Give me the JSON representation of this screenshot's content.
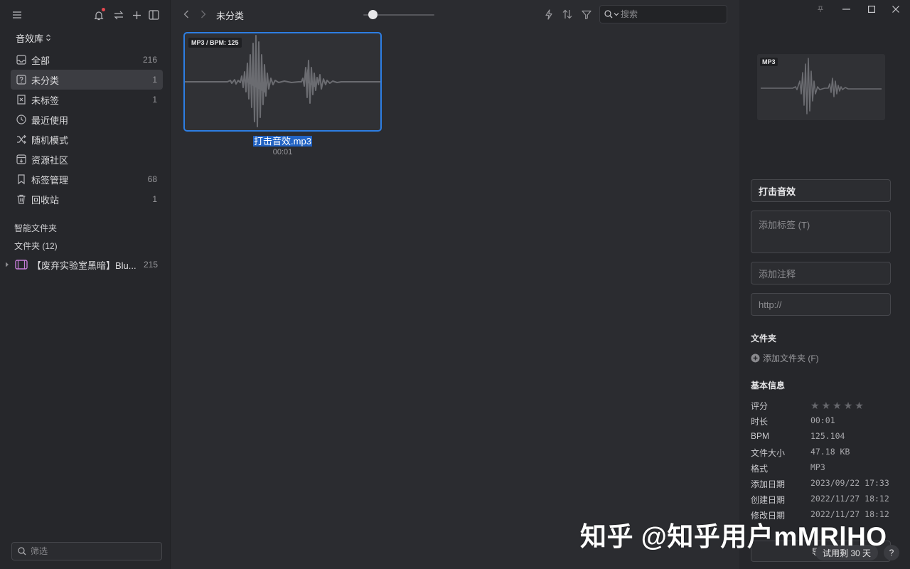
{
  "sidebar": {
    "library": "音效库",
    "items": [
      {
        "label": "全部",
        "count": "216",
        "icon": "inbox-icon"
      },
      {
        "label": "未分类",
        "count": "1",
        "icon": "question-box-icon"
      },
      {
        "label": "未标签",
        "count": "1",
        "icon": "untagged-icon"
      },
      {
        "label": "最近使用",
        "count": "",
        "icon": "clock-icon"
      },
      {
        "label": "随机模式",
        "count": "",
        "icon": "shuffle-icon"
      },
      {
        "label": "资源社区",
        "count": "",
        "icon": "community-icon"
      },
      {
        "label": "标签管理",
        "count": "68",
        "icon": "bookmark-icon"
      },
      {
        "label": "回收站",
        "count": "1",
        "icon": "trash-icon"
      }
    ],
    "smart_folders_label": "智能文件夹",
    "folders_label": "文件夹 (12)",
    "folder": {
      "name": "【废弃实验室黑暗】Blu...",
      "count": "215"
    },
    "filter_placeholder": "筛选"
  },
  "toolbar": {
    "breadcrumb": "未分类",
    "search_placeholder": "搜索",
    "zoom_level": 0.1
  },
  "asset": {
    "tag": "MP3 / BPM: 125",
    "name": "打击音效.mp3",
    "duration": "00:01"
  },
  "inspector": {
    "preview_tag": "MP3",
    "name_value": "打击音效",
    "tags_placeholder": "添加标签 (T)",
    "note_placeholder": "添加注释",
    "url_placeholder": "http://",
    "folder_heading": "文件夹",
    "add_folder": "添加文件夹 (F)",
    "basic_info_heading": "基本信息",
    "rating_label": "评分",
    "rating": 0,
    "info": [
      {
        "k": "时长",
        "v": "00:01"
      },
      {
        "k": "BPM",
        "v": "125.104"
      },
      {
        "k": "文件大小",
        "v": "47.18 KB"
      },
      {
        "k": "格式",
        "v": "MP3"
      },
      {
        "k": "添加日期",
        "v": "2023/09/22 17:33"
      },
      {
        "k": "创建日期",
        "v": "2022/11/27 18:12"
      },
      {
        "k": "修改日期",
        "v": "2022/11/27 18:12"
      }
    ],
    "export_label": "导出",
    "trial_label": "试用剩 30 天",
    "help_label": "?"
  },
  "watermark": "知乎 @知乎用户mMRlHO",
  "colors": {
    "accent": "#2d7ee3",
    "selection": "#2263c3",
    "notification": "#e34850",
    "folder_icon": "#c77dd9"
  }
}
